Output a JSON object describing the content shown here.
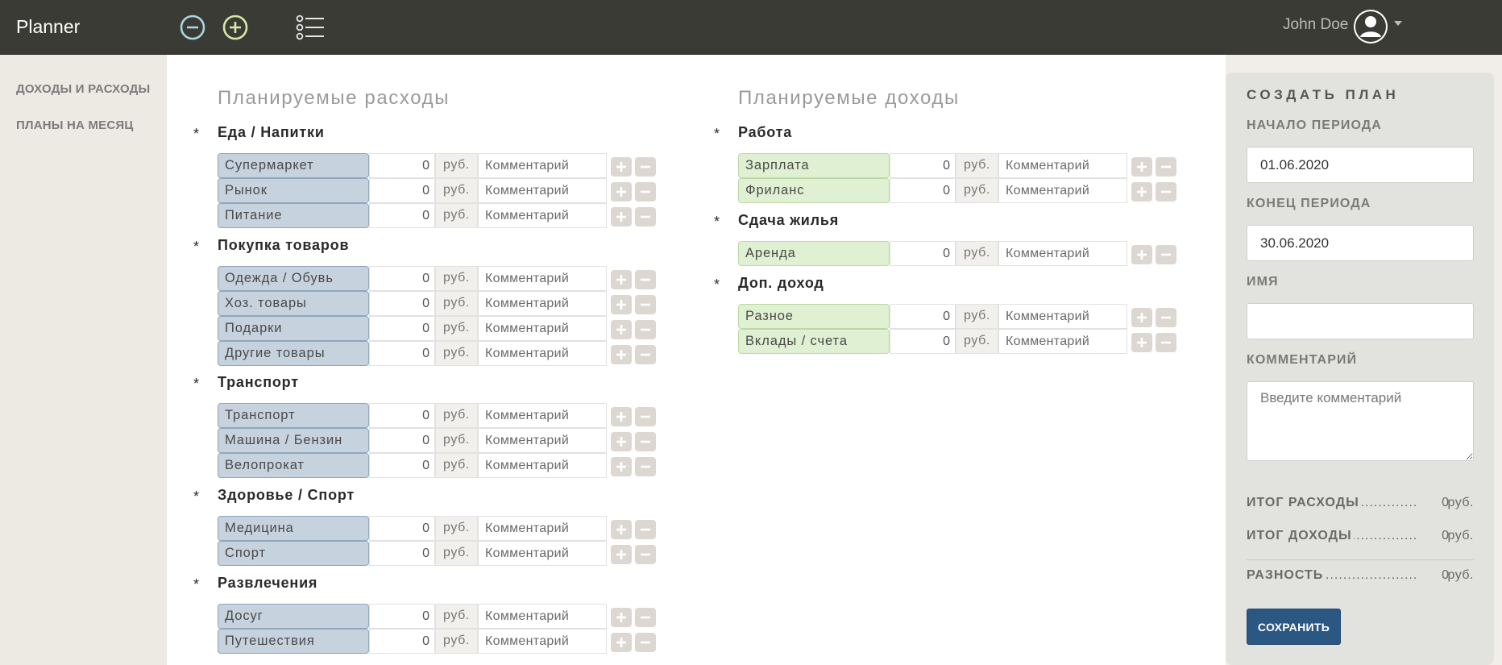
{
  "app": {
    "title": "Planner"
  },
  "header": {
    "zoom_out_icon": "minus-circle-icon",
    "zoom_in_icon": "plus-circle-icon",
    "list_icon": "list-icon",
    "user_name": "John Doe"
  },
  "sidebar": {
    "items": [
      {
        "label": "ДОХОДЫ И РАСХОДЫ"
      },
      {
        "label": "ПЛАНЫ НА МЕСЯЦ"
      }
    ]
  },
  "expenses": {
    "title": "Планируемые расходы",
    "groups": [
      {
        "title": "Еда / Напитки",
        "rows": [
          {
            "label": "Супермаркет",
            "amount": "0",
            "currency": "руб.",
            "comment_placeholder": "Комментарий"
          },
          {
            "label": "Рынок",
            "amount": "0",
            "currency": "руб.",
            "comment_placeholder": "Комментарий"
          },
          {
            "label": "Питание",
            "amount": "0",
            "currency": "руб.",
            "comment_placeholder": "Комментарий"
          }
        ]
      },
      {
        "title": "Покупка товаров",
        "rows": [
          {
            "label": "Одежда / Обувь",
            "amount": "0",
            "currency": "руб.",
            "comment_placeholder": "Комментарий"
          },
          {
            "label": "Хоз. товары",
            "amount": "0",
            "currency": "руб.",
            "comment_placeholder": "Комментарий"
          },
          {
            "label": "Подарки",
            "amount": "0",
            "currency": "руб.",
            "comment_placeholder": "Комментарий"
          },
          {
            "label": "Другие товары",
            "amount": "0",
            "currency": "руб.",
            "comment_placeholder": "Комментарий"
          }
        ]
      },
      {
        "title": "Транспорт",
        "rows": [
          {
            "label": "Транспорт",
            "amount": "0",
            "currency": "руб.",
            "comment_placeholder": "Комментарий"
          },
          {
            "label": "Машина / Бензин",
            "amount": "0",
            "currency": "руб.",
            "comment_placeholder": "Комментарий"
          },
          {
            "label": "Велопрокат",
            "amount": "0",
            "currency": "руб.",
            "comment_placeholder": "Комментарий"
          }
        ]
      },
      {
        "title": "Здоровье / Спорт",
        "rows": [
          {
            "label": "Медицина",
            "amount": "0",
            "currency": "руб.",
            "comment_placeholder": "Комментарий"
          },
          {
            "label": "Спорт",
            "amount": "0",
            "currency": "руб.",
            "comment_placeholder": "Комментарий"
          }
        ]
      },
      {
        "title": "Развлечения",
        "rows": [
          {
            "label": "Досуг",
            "amount": "0",
            "currency": "руб.",
            "comment_placeholder": "Комментарий"
          },
          {
            "label": "Путешествия",
            "amount": "0",
            "currency": "руб.",
            "comment_placeholder": "Комментарий"
          }
        ]
      }
    ]
  },
  "income": {
    "title": "Планируемые доходы",
    "groups": [
      {
        "title": "Работа",
        "rows": [
          {
            "label": "Зарплата",
            "amount": "0",
            "currency": "руб.",
            "comment_placeholder": "Комментарий"
          },
          {
            "label": "Фриланс",
            "amount": "0",
            "currency": "руб.",
            "comment_placeholder": "Комментарий"
          }
        ]
      },
      {
        "title": "Сдача жилья",
        "rows": [
          {
            "label": "Аренда",
            "amount": "0",
            "currency": "руб.",
            "comment_placeholder": "Комментарий"
          }
        ]
      },
      {
        "title": "Доп. доход",
        "rows": [
          {
            "label": "Разное",
            "amount": "0",
            "currency": "руб.",
            "comment_placeholder": "Комментарий"
          },
          {
            "label": "Вклады / счета",
            "amount": "0",
            "currency": "руб.",
            "comment_placeholder": "Комментарий"
          }
        ]
      }
    ]
  },
  "plan": {
    "title": "СОЗДАТЬ ПЛАН",
    "start_label": "НАЧАЛО ПЕРИОДА",
    "start_value": "01.06.2020",
    "end_label": "КОНЕЦ ПЕРИОДА",
    "end_value": "30.06.2020",
    "name_label": "ИМЯ",
    "name_value": "",
    "comment_label": "КОММЕНТАРИЙ",
    "comment_placeholder": "Введите комментарий",
    "total_expenses_label": "ИТОГ РАСХОДЫ",
    "total_expenses_value": "0",
    "total_income_label": "ИТОГ ДОХОДЫ",
    "total_income_value": "0",
    "difference_label": "РАЗНОСТЬ",
    "difference_value": "0",
    "currency": "руб.",
    "save_label": "СОХРАНИТЬ"
  },
  "colors": {
    "topbar": "#3b3b36",
    "expense_category": "#c6d2dd",
    "income_category": "#e0f0d2",
    "save_button": "#2b5783"
  }
}
